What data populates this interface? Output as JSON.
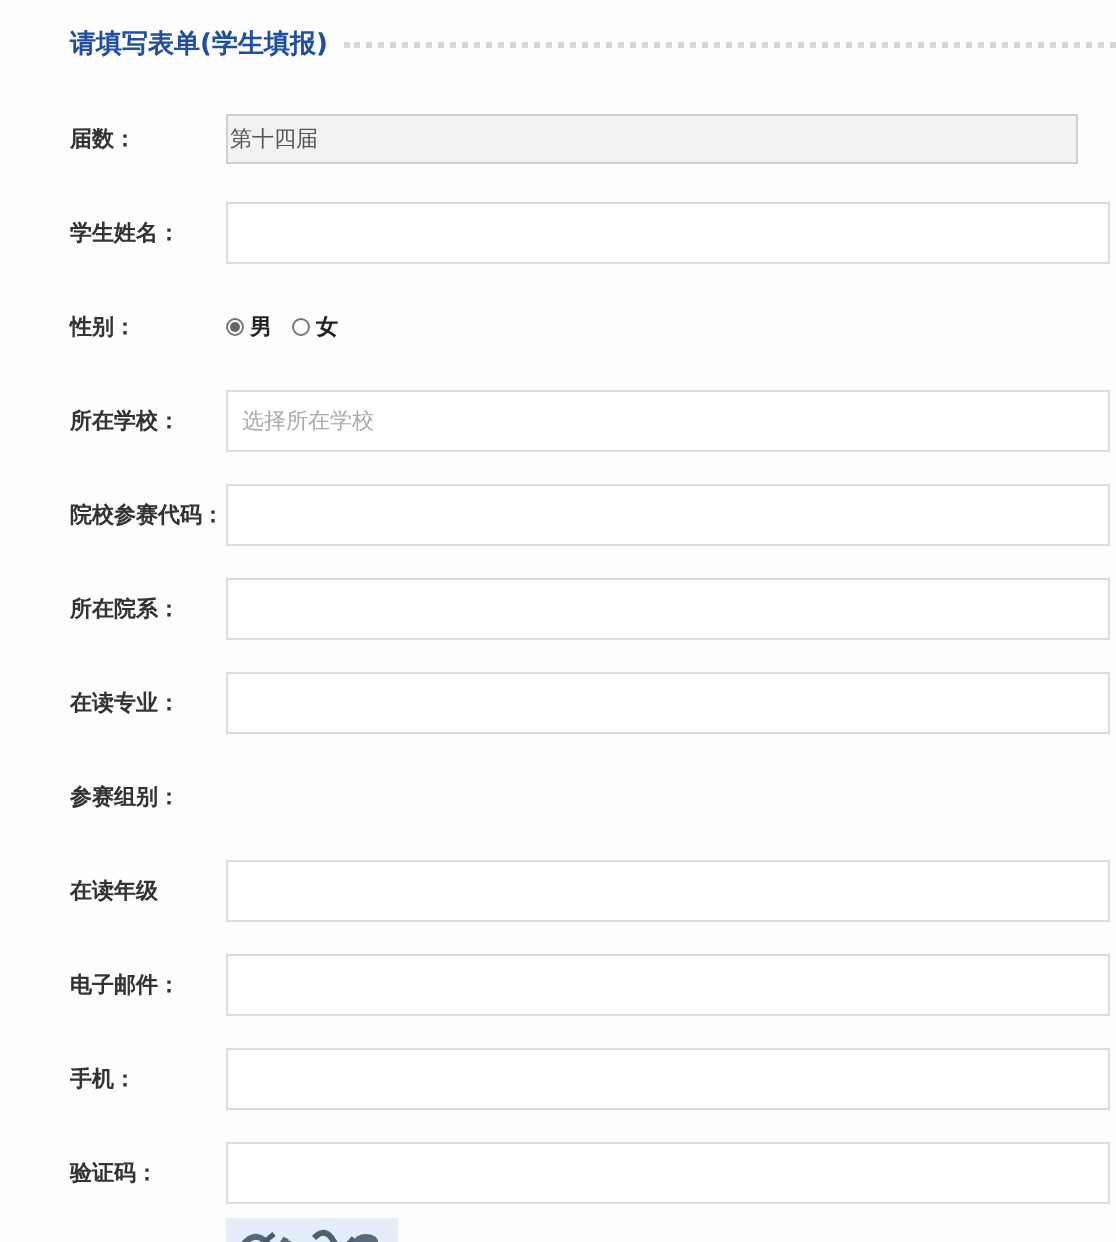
{
  "form_title": "请填写表单(学生填报)",
  "fields": [
    {
      "label": "届数：",
      "kind": "readonly",
      "value": "第十四届"
    },
    {
      "label": "学生姓名：",
      "kind": "text"
    },
    {
      "label": "性别：",
      "kind": "radio",
      "options": [
        {
          "label": "男",
          "selected": true
        },
        {
          "label": "女",
          "selected": false
        }
      ]
    },
    {
      "label": "所在学校：",
      "kind": "select",
      "placeholder": "选择所在学校"
    },
    {
      "label": "院校参赛代码：",
      "kind": "text"
    },
    {
      "label": "所在院系：",
      "kind": "text"
    },
    {
      "label": "在读专业：",
      "kind": "text"
    },
    {
      "label": "参赛组别：",
      "kind": "none"
    },
    {
      "label": "在读年级",
      "kind": "text"
    },
    {
      "label": "电子邮件：",
      "kind": "text"
    },
    {
      "label": "手机：",
      "kind": "text"
    },
    {
      "label": "验证码：",
      "kind": "text"
    }
  ]
}
